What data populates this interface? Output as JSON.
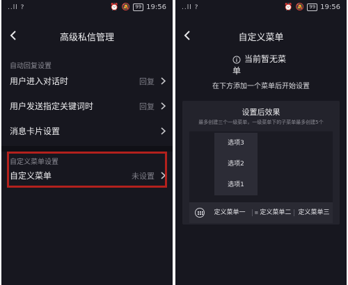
{
  "left": {
    "status": {
      "signal": "..ll ?",
      "time": "19:56",
      "battery": "99"
    },
    "title": "高级私信管理",
    "section_auto": "自动回复设置",
    "rows": [
      {
        "label": "用户进入对话时",
        "value": "回复"
      },
      {
        "label": "用户发送指定关键词时",
        "value": "回复"
      },
      {
        "label": "消息卡片设置",
        "value": ""
      }
    ],
    "section_menu": "自定义菜单设置",
    "menu_row": {
      "label": "自定义菜单",
      "value": "未设置"
    },
    "highlight_color": "#b3211d"
  },
  "right": {
    "status": {
      "signal": "..ll ?",
      "time": "19:56",
      "battery": "99"
    },
    "title": "自定义菜单",
    "empty_title_line1": "当前暂无菜",
    "empty_title_line2": "单",
    "empty_sub": "在下方添加一个菜单后开始设置",
    "card_title": "设置后效果",
    "card_note": "最多创建三个一级菜单，一级菜单下的子菜单最多创建5个",
    "submenu": [
      "选项3",
      "选项2",
      "选项1"
    ],
    "menus": [
      "定义菜单一",
      "定义菜单二",
      "定义菜单三"
    ]
  }
}
